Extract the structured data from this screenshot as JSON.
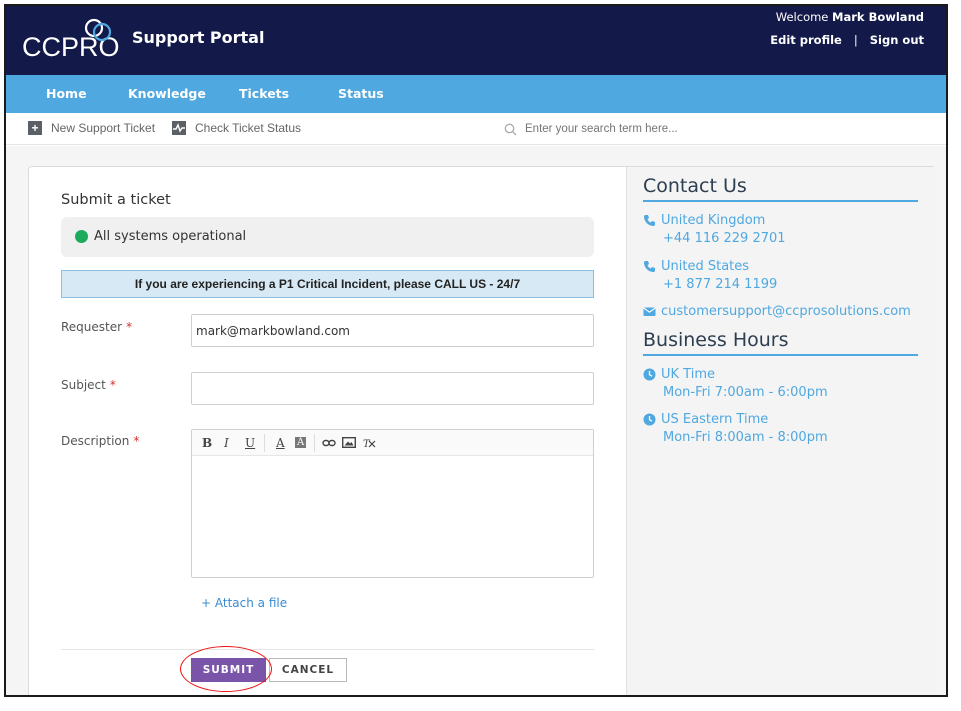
{
  "header": {
    "logo_text": "CCPRO",
    "title": "Support Portal",
    "welcome_prefix": "Welcome",
    "user_name": "Mark Bowland",
    "edit_profile": "Edit profile",
    "separator": "|",
    "sign_out": "Sign out"
  },
  "nav": {
    "items": [
      {
        "label": "Home"
      },
      {
        "label": "Knowledge"
      },
      {
        "label": "Tickets"
      },
      {
        "label": "Status"
      }
    ]
  },
  "subbar": {
    "new_ticket": "New Support Ticket",
    "check_status": "Check Ticket Status",
    "search_placeholder": "Enter your search term here..."
  },
  "form": {
    "title": "Submit a ticket",
    "status_text": "All systems operational",
    "status_color": "#1dab5b",
    "alert_text": "If you are experiencing a P1 Critical Incident, please CALL US - 24/7",
    "requester_label": "Requester",
    "requester_value": "mark@markbowland.com",
    "subject_label": "Subject",
    "subject_value": "",
    "description_label": "Description",
    "required_mark": "*",
    "toolbar": {
      "bold": "B",
      "italic": "I",
      "underline": "U",
      "font_color": "A",
      "bg_color": "A"
    },
    "attach_label": "+ Attach a file",
    "submit_label": "SUBMIT",
    "cancel_label": "CANCEL"
  },
  "contact": {
    "heading": "Contact Us",
    "uk_label": "United Kingdom",
    "uk_phone": "+44 116 229 2701",
    "us_label": "United States",
    "us_phone": "+1 877 214 1199",
    "email": "customersupport@ccprosolutions.com"
  },
  "hours": {
    "heading": "Business Hours",
    "uk_label": "UK Time",
    "uk_hours": "Mon-Fri 7:00am - 6:00pm",
    "us_label": "US Eastern Time",
    "us_hours": "Mon-Fri 8:00am - 8:00pm"
  },
  "colors": {
    "header_bg": "#131a4a",
    "nav_bg": "#4fa8e0",
    "submit_bg": "#7a54a8",
    "link": "#4fa8e0"
  }
}
